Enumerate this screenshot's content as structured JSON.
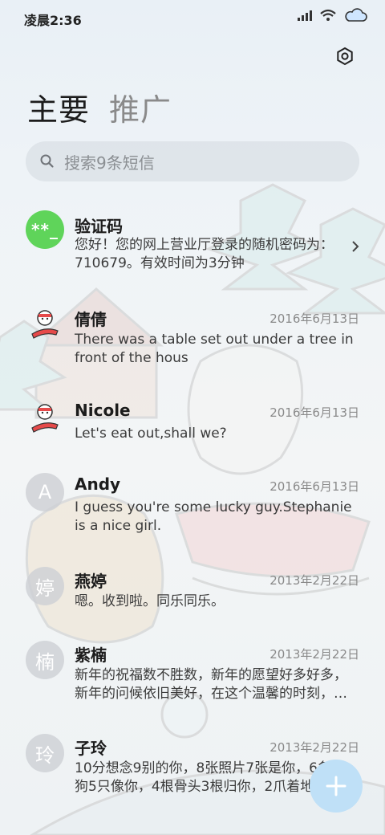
{
  "status_bar": {
    "time": "凌晨2:36"
  },
  "tabs": [
    {
      "label": "主要"
    },
    {
      "label": "推广"
    }
  ],
  "search": {
    "placeholder": "搜索9条短信"
  },
  "messages": [
    {
      "avatar_text": "**_",
      "name": "验证码",
      "date": "",
      "preview": "您好！您的网上营业厅登录的随机密码为：710679。有效时间为3分钟"
    },
    {
      "avatar_text": "",
      "name": "倩倩",
      "date": "2016年6月13日",
      "preview": "There was a table set out under a tree in front of the hous"
    },
    {
      "avatar_text": "",
      "name": "Nicole",
      "date": "2016年6月13日",
      "preview": "Let's eat out,shall we?"
    },
    {
      "avatar_text": "A",
      "name": "Andy",
      "date": "2016年6月13日",
      "preview": "I guess you're some lucky guy.Stephanie is a nice girl."
    },
    {
      "avatar_text": "婷",
      "name": "燕婷",
      "date": "2013年2月22日",
      "preview": "嗯。收到啦。同乐同乐。"
    },
    {
      "avatar_text": "楠",
      "name": "紫楠",
      "date": "2013年2月22日",
      "preview": "新年的祝福数不胜数，新年的愿望好多好多，新年的问候依旧美好，在这个温馨的时刻，…"
    },
    {
      "avatar_text": "玲",
      "name": "子玲",
      "date": "2013年2月22日",
      "preview": "10分想念9别的你，8张照片7张是你，6条小狗5只像你，4根骨头3根归你，2爪着地"
    }
  ],
  "colors": {
    "accent_green": "#5fd45a",
    "fab": "#bfe0f7"
  },
  "icons": {
    "settings": "gear-icon",
    "search": "search-icon",
    "fab": "plus-icon",
    "chevron": "chevron-right-icon"
  }
}
